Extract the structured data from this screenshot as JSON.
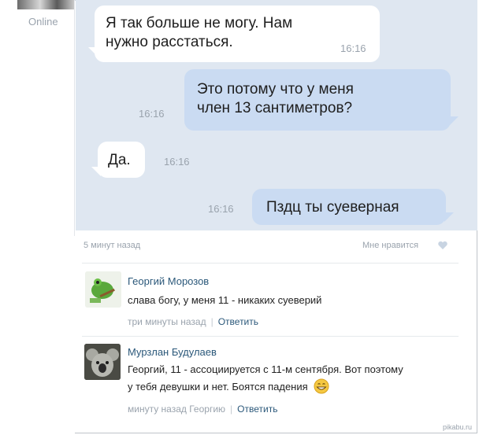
{
  "profile": {
    "status": "Online"
  },
  "messages": [
    {
      "text_l1": "Я так больше не могу. Нам",
      "text_l2": "нужно расстаться.",
      "time": "16:16",
      "dir": "in"
    },
    {
      "text_l1": "Это потому что у меня",
      "text_l2": "член 13 сантиметров?",
      "time": "16:16",
      "dir": "out"
    },
    {
      "text": "Да.",
      "time": "16:16",
      "dir": "in"
    },
    {
      "text": "Пздц ты суеверная",
      "time": "16:16",
      "dir": "out"
    }
  ],
  "post": {
    "timestamp": "5 минут назад",
    "like_label": "Мне нравится"
  },
  "comments": [
    {
      "author": "Георгий Морозов",
      "text": "слава богу, у меня 11 - никаких суеверий",
      "time": "три минуты назад",
      "reply_label": "Ответить"
    },
    {
      "author": "Мурзлан Будулаев",
      "text_l1": "Георгий, 11 - ассоциируется с 11-м сентября. Вот поэтому",
      "text_l2": "у тебя девушки и нет. Боятся падения",
      "time": "минуту назад Георгию",
      "reply_label": "Ответить"
    }
  ],
  "watermark": "pikabu.ru",
  "colors": {
    "chat_bg": "#dfe7f1",
    "bubble_out": "#cadbf2",
    "link": "#2b587a"
  },
  "icons": [
    "heart-icon",
    "grin-emoji-icon"
  ]
}
